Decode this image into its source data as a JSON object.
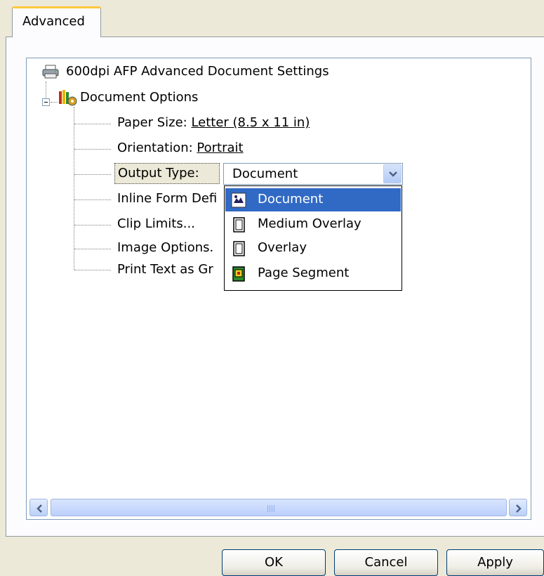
{
  "tab": {
    "label": "Advanced"
  },
  "tree": {
    "root_label": "600dpi AFP Advanced Document Settings",
    "group_label": "Document Options",
    "items": [
      {
        "label": "Paper Size: ",
        "value": "Letter (8.5 x 11 in)"
      },
      {
        "label": "Orientation: ",
        "value": "Portrait"
      },
      {
        "label": "Output Type:"
      },
      {
        "label": "Inline Form Defi"
      },
      {
        "label": "Clip Limits..."
      },
      {
        "label": "Image Options."
      },
      {
        "label": "Print Text as Gr"
      }
    ]
  },
  "output_type": {
    "selected": "Document",
    "options": [
      "Document",
      "Medium Overlay",
      "Overlay",
      "Page Segment"
    ]
  },
  "scrollbar": {
    "left_arrow": "◀",
    "right_arrow": "▶"
  },
  "buttons": {
    "ok": "OK",
    "cancel": "Cancel",
    "apply": "Apply"
  },
  "colors": {
    "selection": "#316AC5",
    "tab_accent": "#FFC83C",
    "dialog_bg": "#ECE9D8"
  }
}
